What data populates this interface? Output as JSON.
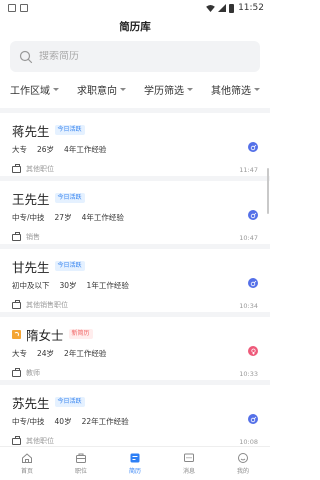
{
  "status": {
    "time": "11:52"
  },
  "header": {
    "title": "简历库"
  },
  "search": {
    "placeholder": "搜索简历"
  },
  "filters": [
    "工作区域",
    "求职意向",
    "学历筛选",
    "其他筛选"
  ],
  "candidates": [
    {
      "name": "蒋先生",
      "badge": "今日活跃",
      "badge_type": "active",
      "education": "大专",
      "age": "26岁",
      "experience": "4年工作经验",
      "position": "其他职位",
      "gender": "male",
      "time": "11:47"
    },
    {
      "name": "王先生",
      "badge": "今日活跃",
      "badge_type": "active",
      "education": "中专/中技",
      "age": "27岁",
      "experience": "4年工作经验",
      "position": "销售",
      "gender": "male",
      "time": "10:47"
    },
    {
      "name": "甘先生",
      "badge": "今日活跃",
      "badge_type": "active",
      "education": "初中及以下",
      "age": "30岁",
      "experience": "1年工作经验",
      "position": "其他销售职位",
      "gender": "male",
      "time": "10:34"
    },
    {
      "name": "隋女士",
      "badge": "新简历",
      "badge_type": "new",
      "education": "大专",
      "age": "24岁",
      "experience": "2年工作经验",
      "position": "教师",
      "gender": "female",
      "time": "10:33"
    },
    {
      "name": "苏先生",
      "badge": "今日活跃",
      "badge_type": "active",
      "education": "中专/中技",
      "age": "40岁",
      "experience": "22年工作经验",
      "position": "其他职位",
      "gender": "male",
      "time": "10:08"
    }
  ],
  "tabbar": [
    {
      "label": "首页",
      "icon": "home-icon",
      "active": false
    },
    {
      "label": "职位",
      "icon": "briefcase-icon",
      "active": false
    },
    {
      "label": "简历",
      "icon": "resume-icon",
      "active": true
    },
    {
      "label": "消息",
      "icon": "message-icon",
      "active": false
    },
    {
      "label": "我的",
      "icon": "profile-icon",
      "active": false
    }
  ],
  "colors": {
    "accent": "#2d7ff5",
    "male": "#5470e8",
    "female": "#ee5a7a",
    "new_icon": "#f4a534"
  }
}
